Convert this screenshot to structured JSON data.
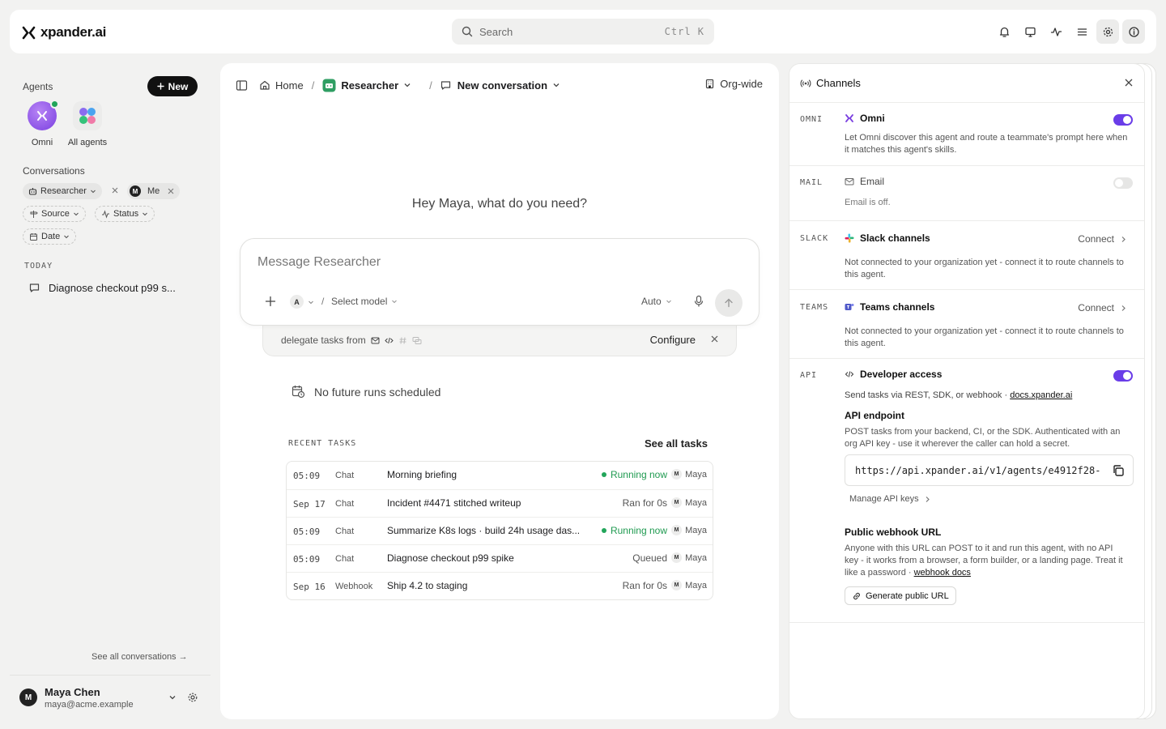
{
  "brand": {
    "name": "xpander.ai"
  },
  "search": {
    "placeholder": "Search",
    "shortcut": "Ctrl K"
  },
  "top_icons": [
    "bell-icon",
    "monitor-icon",
    "activity-icon",
    "list-icon",
    "gear-icon",
    "info-icon"
  ],
  "sidebar": {
    "agents_label": "Agents",
    "new_label": "New",
    "agents": [
      {
        "name": "Omni",
        "online": true
      },
      {
        "name": "All agents"
      }
    ],
    "conversations_label": "Conversations",
    "filters": {
      "agent": "Researcher",
      "me_initial": "M",
      "me": "Me",
      "source": "Source",
      "status": "Status",
      "date": "Date"
    },
    "today_label": "TODAY",
    "conversation": "Diagnose checkout p99 s...",
    "see_all": "See all conversations →",
    "user": {
      "initial": "M",
      "name": "Maya Chen",
      "email": "maya@acme.example"
    }
  },
  "main": {
    "breadcrumb": {
      "home": "Home",
      "agent": "Researcher",
      "conversation": "New conversation"
    },
    "scope": "Org-wide",
    "greeting": "Hey Maya, what do you need?",
    "composer": {
      "placeholder": "Message Researcher",
      "agent_initial": "A",
      "model": "Select model",
      "mode": "Auto"
    },
    "delegate": {
      "text": "delegate tasks from",
      "configure": "Configure"
    },
    "future_runs": "No future runs scheduled",
    "recent_tasks_label": "RECENT TASKS",
    "see_all_tasks": "See all tasks",
    "tasks": [
      {
        "time": "05:09",
        "source": "Chat",
        "title": "Morning briefing",
        "status": "Running now",
        "running": true,
        "user_initial": "M",
        "user": "Maya"
      },
      {
        "time": "Sep 17",
        "source": "Chat",
        "title": "Incident #4471 stitched writeup",
        "status": "Ran for 0s",
        "running": false,
        "user_initial": "M",
        "user": "Maya"
      },
      {
        "time": "05:09",
        "source": "Chat",
        "title": "Summarize K8s logs · build 24h usage das...",
        "status": "Running now",
        "running": true,
        "user_initial": "M",
        "user": "Maya"
      },
      {
        "time": "05:09",
        "source": "Chat",
        "title": "Diagnose checkout p99 spike",
        "status": "Queued",
        "running": false,
        "user_initial": "M",
        "user": "Maya"
      },
      {
        "time": "Sep 16",
        "source": "Webhook",
        "title": "Ship 4.2 to staging",
        "status": "Ran for 0s",
        "running": false,
        "user_initial": "M",
        "user": "Maya"
      }
    ]
  },
  "channels": {
    "title": "Channels",
    "omni": {
      "code": "OMNI",
      "name": "Omni",
      "enabled": true,
      "desc": "Let Omni discover this agent and route a teammate's prompt here when it matches this agent's skills."
    },
    "mail": {
      "code": "MAIL",
      "name": "Email",
      "enabled": false,
      "desc": "Email is off."
    },
    "slack": {
      "code": "SLACK",
      "name": "Slack channels",
      "action": "Connect",
      "desc": "Not connected to your organization yet - connect it to route channels to this agent."
    },
    "teams": {
      "code": "TEAMS",
      "name": "Teams channels",
      "action": "Connect",
      "desc": "Not connected to your organization yet - connect it to route channels to this agent."
    },
    "api": {
      "code": "API",
      "name": "Developer access",
      "enabled": true,
      "desc": "Send tasks via REST, SDK, or webhook ·",
      "docs_link": "docs.xpander.ai",
      "endpoint_title": "API endpoint",
      "endpoint_desc": "POST tasks from your backend, CI, or the SDK. Authenticated with an org API key - use it wherever the caller can hold a secret.",
      "endpoint_url": "https://api.xpander.ai/v1/agents/e4912f28-",
      "manage_keys": "Manage API keys",
      "webhook_title": "Public webhook URL",
      "webhook_desc": "Anyone with this URL can POST to it and run this agent, with no API key - it works from a browser, a form builder, or a landing page. Treat it like a password ·",
      "webhook_link": "webhook docs",
      "generate": "Generate public URL"
    }
  },
  "colors": {
    "accent": "#6a3de8",
    "running": "#1f9a50",
    "dark": "#111111"
  }
}
